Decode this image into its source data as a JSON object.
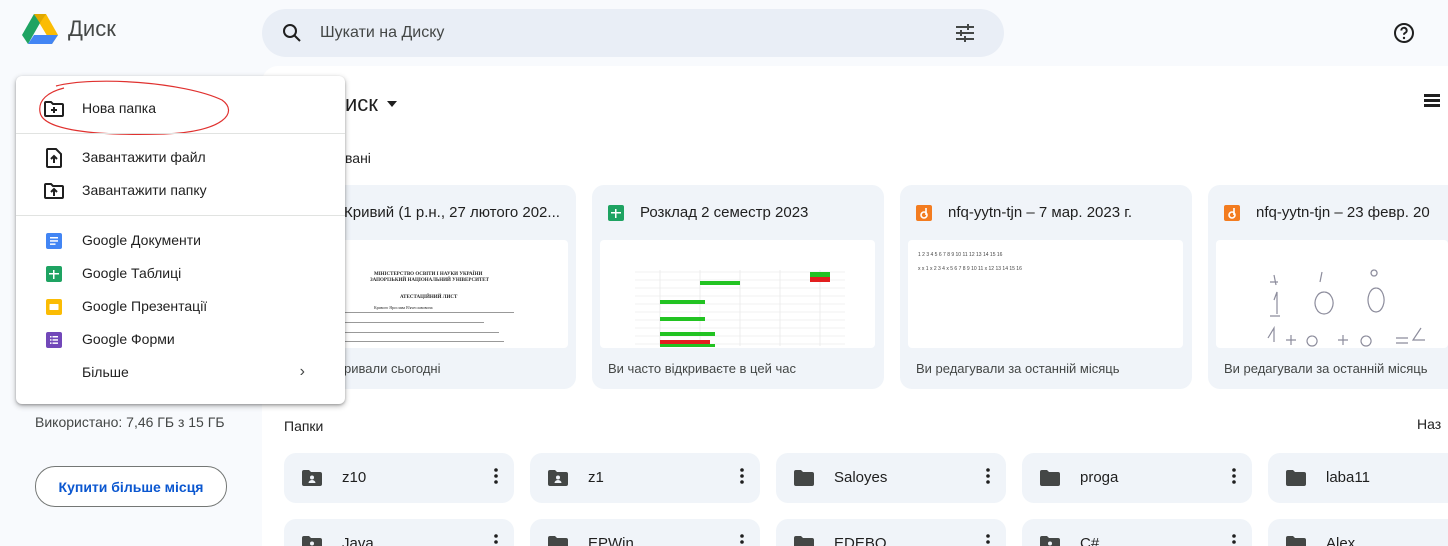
{
  "app": {
    "name": "Диск"
  },
  "search": {
    "placeholder": "Шукати на Диску"
  },
  "main": {
    "title_visible": "иск",
    "suggested_visible": "вані",
    "folders_heading": "Папки",
    "sort_label_visible": "Наз"
  },
  "cards": [
    {
      "title": "Кривий (1 р.н., 27 лютого 202...",
      "reason": "ривали сьогодні",
      "type": "doc-partial"
    },
    {
      "title": "Розклад 2 семестр 2023",
      "reason": "Ви часто відкриваєте в цей час",
      "type": "sheets"
    },
    {
      "title": "nfq-yytn-tjn – 7 мар. 2023 г.",
      "reason": "Ви редагували за останній місяць",
      "type": "jamboard",
      "thumb_lines": [
        "1 2 3 4 5 6 7 8 9 10 11 12 13 14 15 16",
        "x x 1 x 2 3 4 x 5 6 7 8 9 10 11 x 12 13 14 15 16"
      ]
    },
    {
      "title": "nfq-yytn-tjn – 23 февр. 20",
      "reason": "Ви редагували за останній місяць",
      "type": "jamboard"
    }
  ],
  "doc_thumb": {
    "line1": "МІНІСТЕРСТВО ОСВІТИ І НАУКИ УКРАЇНИ",
    "line2": "ЗАПОРІЗЬКИЙ НАЦІОНАЛЬНИЙ УНІВЕРСИТЕТ",
    "line3": "АТЕСТАЦІЙНИЙ ЛИСТ",
    "line4": "Кривого Ярослава В'ячеславовича"
  },
  "folders_row1": [
    {
      "name": "z10",
      "shared": true
    },
    {
      "name": "z1",
      "shared": true
    },
    {
      "name": "Saloyes",
      "shared": false
    },
    {
      "name": "proga",
      "shared": false
    },
    {
      "name": "laba11",
      "shared": false
    }
  ],
  "folders_row2": [
    {
      "name": "Java",
      "shared": true
    },
    {
      "name": "EPWin",
      "shared": false
    },
    {
      "name": "EDEBO",
      "shared": false
    },
    {
      "name": "C#",
      "shared": true
    },
    {
      "name": "Alex",
      "shared": false
    }
  ],
  "storage": {
    "text": "Використано: 7,46 ГБ з 15 ГБ",
    "buy_label": "Купити більше місця"
  },
  "menu": {
    "new_folder": "Нова папка",
    "upload_file": "Завантажити файл",
    "upload_folder": "Завантажити папку",
    "docs": "Google Документи",
    "sheets": "Google Таблиці",
    "slides": "Google Презентації",
    "forms": "Google Форми",
    "more": "Більше"
  },
  "colors": {
    "accent": "#0b57d0",
    "sheets": "#1ea362",
    "docs": "#4285f4",
    "slides": "#fbbc04",
    "forms": "#7248b9",
    "jamboard": "#f37c20",
    "annotation": "#e0312f"
  }
}
